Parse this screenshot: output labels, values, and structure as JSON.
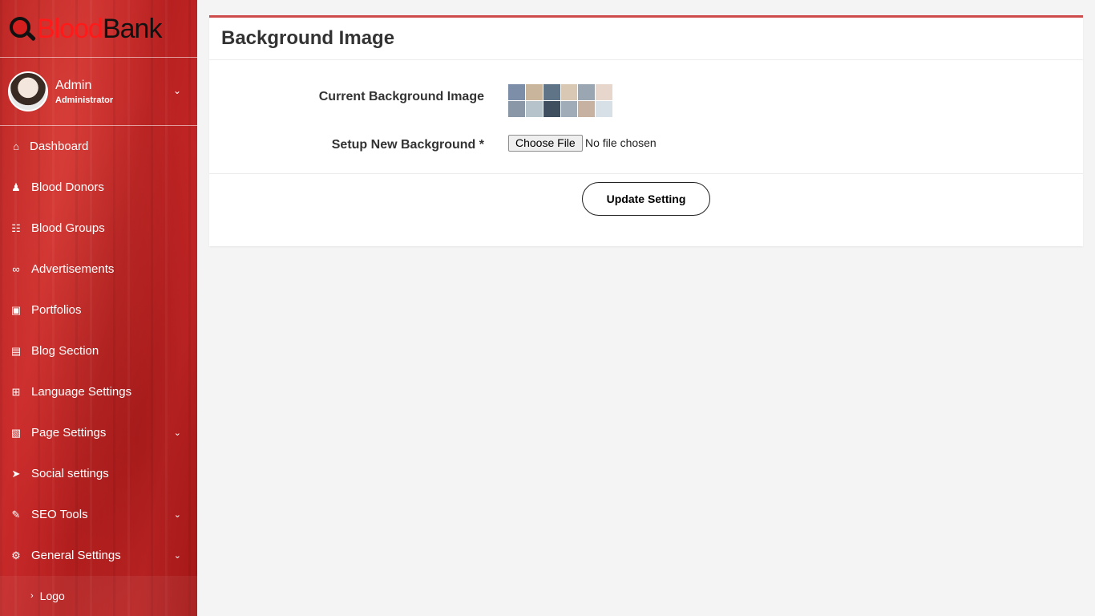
{
  "brand": {
    "part1": "Blood",
    "part2": "Bank"
  },
  "user": {
    "name": "Admin",
    "role": "Administrator"
  },
  "sidebar": {
    "items": [
      {
        "label": "Dashboard",
        "icon": "home-icon",
        "glyph": "⌂"
      },
      {
        "label": "Blood Donors",
        "icon": "user-icon",
        "glyph": "♟"
      },
      {
        "label": "Blood Groups",
        "icon": "sitemap-icon",
        "glyph": "☷"
      },
      {
        "label": "Advertisements",
        "icon": "link-icon",
        "glyph": "∞"
      },
      {
        "label": "Portfolios",
        "icon": "image-icon",
        "glyph": "▣"
      },
      {
        "label": "Blog Section",
        "icon": "file-icon",
        "glyph": "▤"
      },
      {
        "label": "Language Settings",
        "icon": "language-icon",
        "glyph": "⊞"
      },
      {
        "label": "Page Settings",
        "icon": "file-image-icon",
        "glyph": "▧"
      },
      {
        "label": "Social settings",
        "icon": "paper-plane-icon",
        "glyph": "➤"
      },
      {
        "label": "SEO Tools",
        "icon": "wrench-icon",
        "glyph": "✎"
      },
      {
        "label": "General Settings",
        "icon": "cogs-icon",
        "glyph": "⚙"
      }
    ],
    "sub_items": [
      {
        "label": "Logo"
      }
    ]
  },
  "card": {
    "title": "Background Image",
    "current_label": "Current Background Image",
    "setup_label": "Setup New Background *",
    "file_button": "Choose File",
    "file_status": "No file chosen",
    "update_button": "Update Setting"
  },
  "colors": {
    "sidebar_red": "#c62828",
    "card_accent": "#cd4b4b",
    "background": "#f4f4f4"
  }
}
